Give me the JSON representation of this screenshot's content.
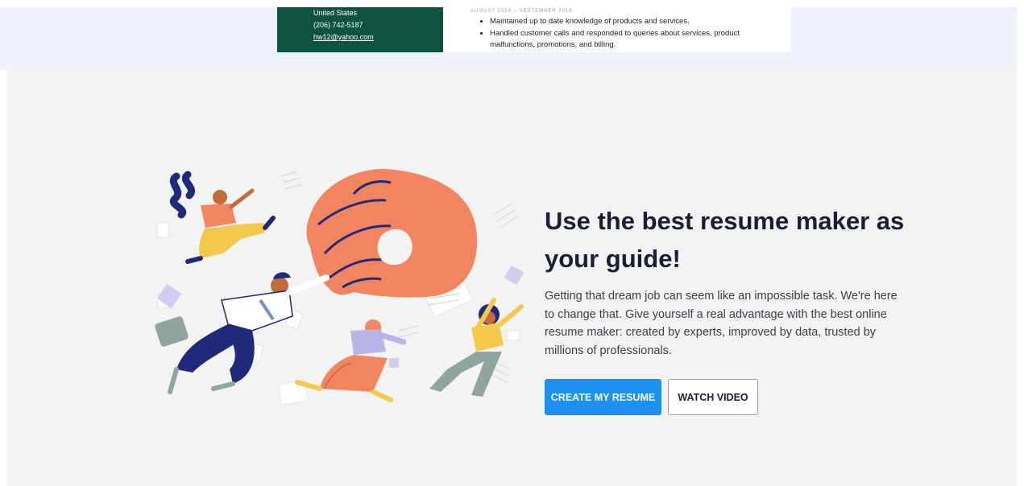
{
  "resume_preview": {
    "country": "United States",
    "phone": "(206) 742-5187",
    "email": "hw12@yahoo.com",
    "dates": "AUGUST 2014 – SEPTEMBER 2019",
    "bullets": [
      "Maintained up to date knowledge of products and services.",
      "Handled customer calls and responded to queries about services, product",
      "malfunctions, promotions, and billing."
    ]
  },
  "hero": {
    "headline": "Use the best resume maker as your guide!",
    "body": "Getting that dream job can seem like an impossible task. We're here to change that. Give yourself a real advantage with the best online resume maker: created by experts, improved by data, trusted by millions of professionals.",
    "primary_button": "CREATE MY RESUME",
    "secondary_button": "WATCH VIDEO"
  },
  "colors": {
    "resume_sidebar": "#0c5342",
    "primary_button": "#1e90f0",
    "hand": "#f2855f",
    "figure_navy": "#1f2a7a",
    "figure_yellow": "#f3c84b",
    "figure_lavender": "#b9b4e6"
  }
}
